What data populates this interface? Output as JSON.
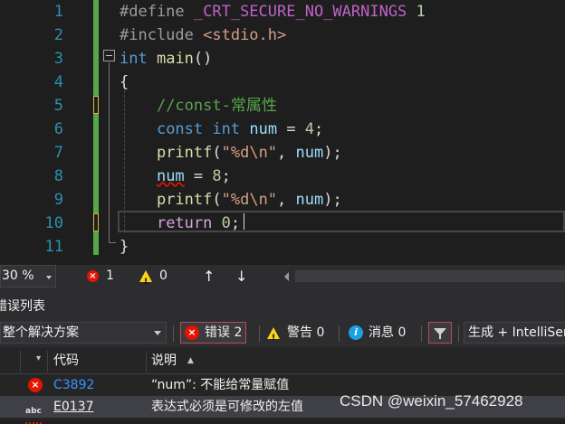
{
  "editor": {
    "line_numbers": [
      "1",
      "2",
      "3",
      "4",
      "5",
      "6",
      "7",
      "8",
      "9",
      "10",
      "11"
    ],
    "lines": {
      "l1": {
        "pp": "#define ",
        "macro": "_CRT_SECURE_NO_WARNINGS",
        "rest": " 1"
      },
      "l2": {
        "pp": "#include ",
        "str": "<stdio.h>"
      },
      "l3": {
        "kw": "int",
        "fn": "main",
        "rest": "()"
      },
      "l4": {
        "text": "{"
      },
      "l5": {
        "comment": "//const-常属性"
      },
      "l6": {
        "kw": "const",
        "kw2": "int",
        "var": "num",
        "rest": " = ",
        "num": "4",
        "end": ";"
      },
      "l7": {
        "fn": "printf",
        "open": "(",
        "str": "\"%d\\n\"",
        "mid": ", ",
        "var": "num",
        "end": ");"
      },
      "l8": {
        "var": "num",
        "rest": " = ",
        "num": "8",
        "end": ";"
      },
      "l9": {
        "fn": "printf",
        "open": "(",
        "str": "\"%d\\n\"",
        "mid": ", ",
        "var": "num",
        "end": ");"
      },
      "l10": {
        "ctl": "return",
        "num": "0",
        "end": ";"
      },
      "l11": {
        "text": "}"
      }
    }
  },
  "statusbar": {
    "zoom": "30 %",
    "error_count": "1",
    "warning_count": "0",
    "up_arrow": "↑",
    "down_arrow": "↓"
  },
  "error_list": {
    "title": "错误列表",
    "scope": "整个解决方案",
    "errors_label": "错误 2",
    "warnings_label": "警告 0",
    "messages_label": "消息 0",
    "build_source": "生成 + IntelliSense",
    "columns": {
      "code": "代码",
      "description": "说明"
    },
    "rows": [
      {
        "code": "C3892",
        "description": "“num”: 不能给常量赋值"
      },
      {
        "code": "E0137",
        "description": "表达式必须是可修改的左值"
      }
    ]
  },
  "watermark": "CSDN @weixin_57462928",
  "colors": {
    "keyword": "#569cd6",
    "comment": "#57a64a",
    "error": "#e51400",
    "warning": "#f8d31e",
    "link": "#3794ff"
  }
}
